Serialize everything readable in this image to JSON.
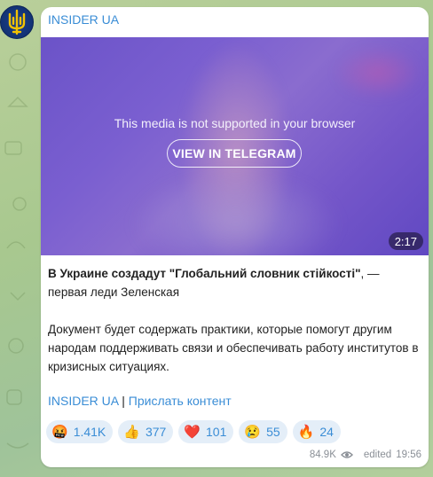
{
  "channel": {
    "name": "INSIDER UA"
  },
  "media": {
    "unsupported_message": "This media is not supported in your browser",
    "view_button": "VIEW IN TELEGRAM",
    "duration": "2:17"
  },
  "post": {
    "headline_bold": "В Украине создадут \"Глобальний словник стійкості\"",
    "headline_rest": ", — первая леди Зеленская",
    "body": "Документ будет содержать практики, которые помогут другим народам поддерживать связи и обеспечивать работу институтов в кризисных ситуациях."
  },
  "footer_links": {
    "channel_link": "INSIDER UA",
    "separator": "|",
    "submit_link": "Прислать контент"
  },
  "reactions": [
    {
      "emoji": "🤬",
      "icon": "angry-face-icon",
      "count": "1.41K"
    },
    {
      "emoji": "👍",
      "icon": "thumbs-up-icon",
      "count": "377"
    },
    {
      "emoji": "❤️",
      "icon": "heart-icon",
      "count": "101"
    },
    {
      "emoji": "😢",
      "icon": "crying-face-icon",
      "count": "55"
    },
    {
      "emoji": "🔥",
      "icon": "fire-icon",
      "count": "24"
    }
  ],
  "meta": {
    "views": "84.9K",
    "edited_label": "edited",
    "time": "19:56"
  },
  "colors": {
    "accent": "#3a8dd6",
    "reaction_bg": "#e4eef8",
    "media_bg": "#6b53c8"
  }
}
